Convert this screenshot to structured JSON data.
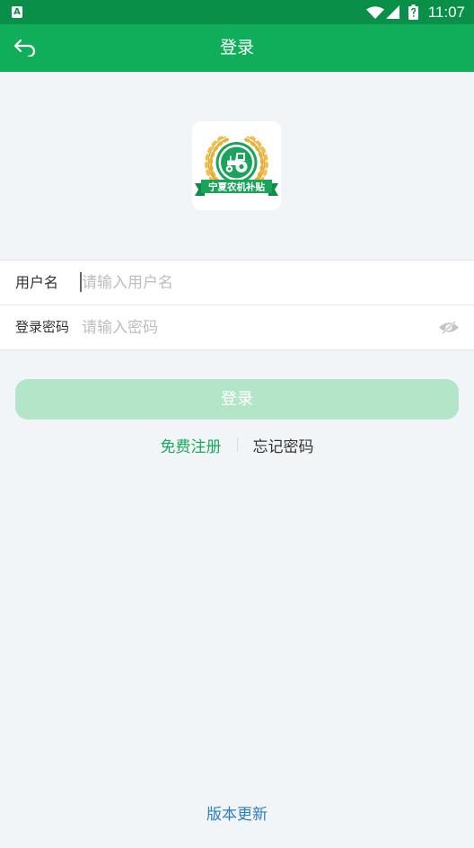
{
  "status_bar": {
    "notification_letter": "A",
    "notification_icon": "a-notification-icon",
    "wifi_icon": "wifi-icon",
    "signal_icon": "cell-signal-icon",
    "battery_icon": "battery-icon",
    "time": "11:07"
  },
  "toolbar": {
    "back_icon": "back-arrow-icon",
    "title": "登录"
  },
  "logo": {
    "icon": "wheat-tractor-badge",
    "ribbon_text": "宁夏农机补贴"
  },
  "form": {
    "username": {
      "label": "用户名",
      "placeholder": "请输入用户名",
      "value": ""
    },
    "password": {
      "label": "登录密码",
      "placeholder": "请输入密码",
      "value": "",
      "toggle_icon": "eye-slash-icon"
    }
  },
  "login_button": {
    "label": "登录",
    "enabled": false
  },
  "links": {
    "register": "免费注册",
    "forgot_password": "忘记密码"
  },
  "footer": {
    "version_update": "版本更新"
  },
  "colors": {
    "status_bar": "#0a8f48",
    "toolbar": "#10ae5a",
    "background": "#f2f5f7",
    "login_button_disabled": "#b3e5c8",
    "register_link": "#19a95e",
    "version_link": "#2a7fc0",
    "text_primary": "#333333",
    "placeholder": "#bdbdbd"
  }
}
